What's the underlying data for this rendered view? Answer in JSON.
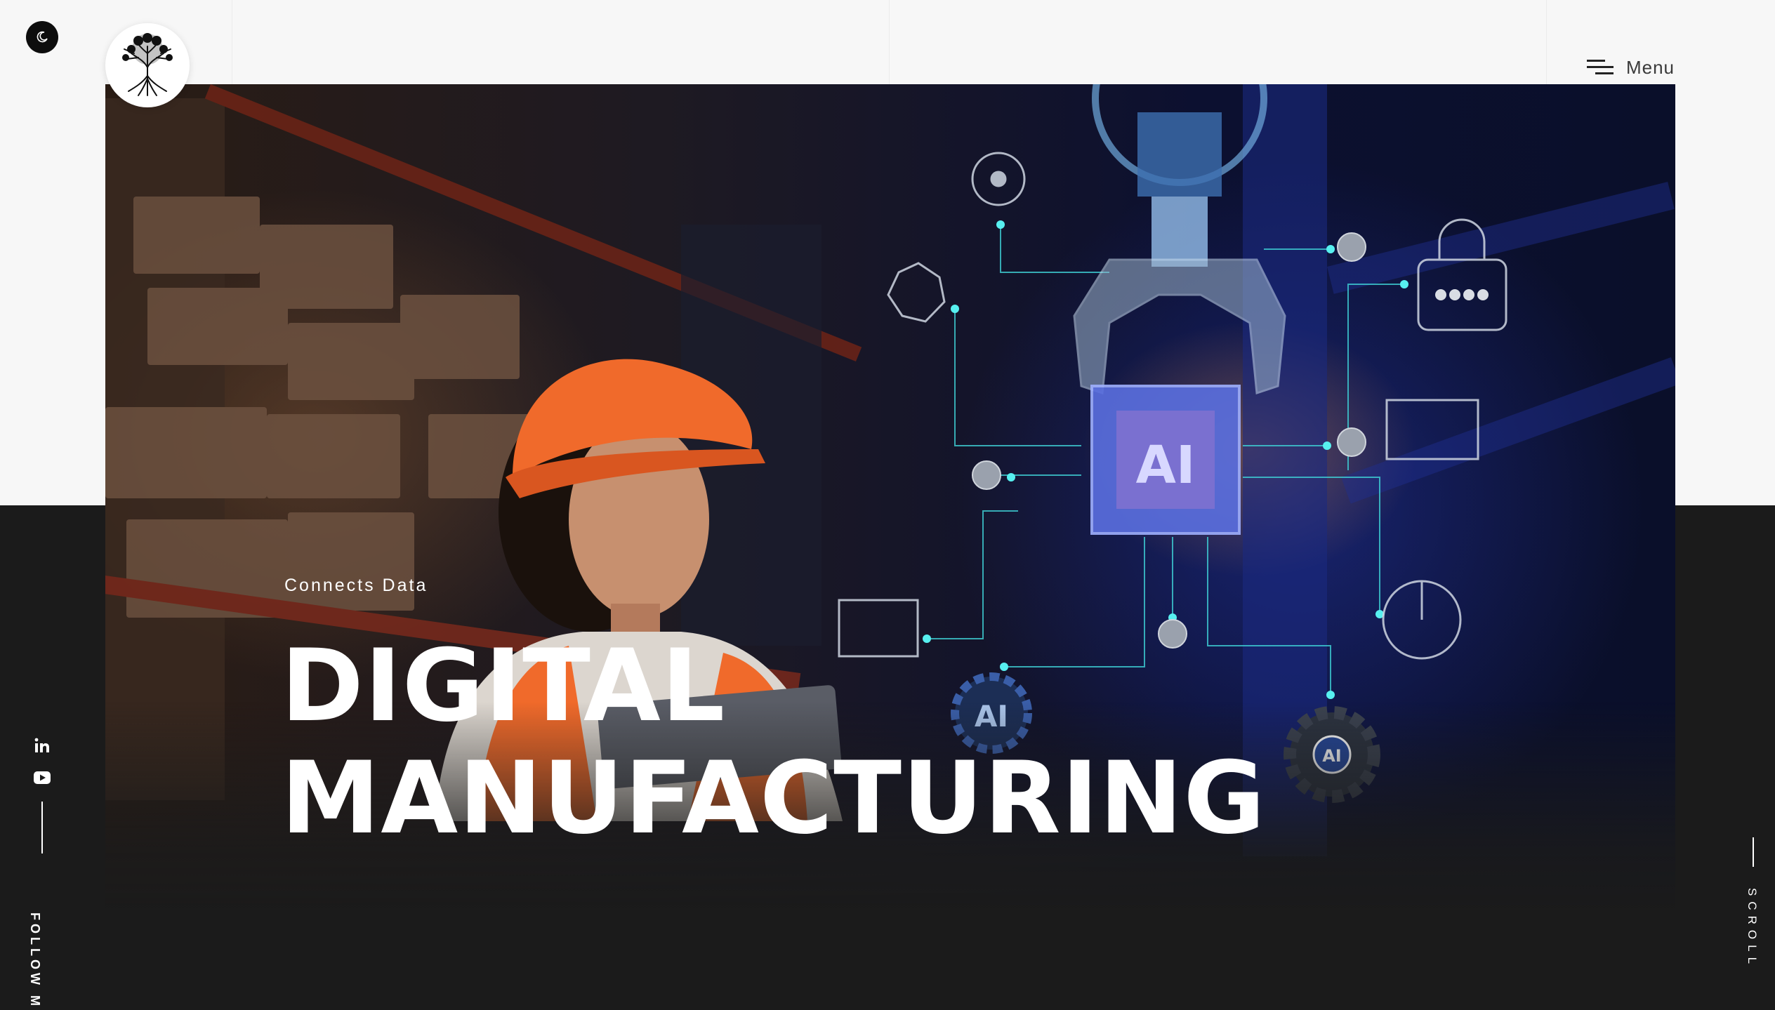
{
  "header": {
    "menu_label": "Menu"
  },
  "theme_toggle": {
    "icon": "moon-icon"
  },
  "logo": {
    "icon": "tree-logo-icon"
  },
  "hero": {
    "eyebrow": "Connects Data",
    "title_line_1": "DIGITAL",
    "title_line_2": "MANUFACTURING",
    "chip_label": "AI",
    "gear_label_1": "AI",
    "gear_label_2": "AI"
  },
  "social": {
    "items": [
      {
        "name": "linkedin-icon",
        "label": "in"
      },
      {
        "name": "youtube-icon"
      }
    ],
    "follow_label": "FOLLOW ME"
  },
  "scroll_label": "SCROLL",
  "colors": {
    "top_background": "#f7f7f7",
    "dark_background": "#1b1b1b",
    "circuit_cyan": "#3fd1d6",
    "helmet_orange": "#f06a2b"
  }
}
